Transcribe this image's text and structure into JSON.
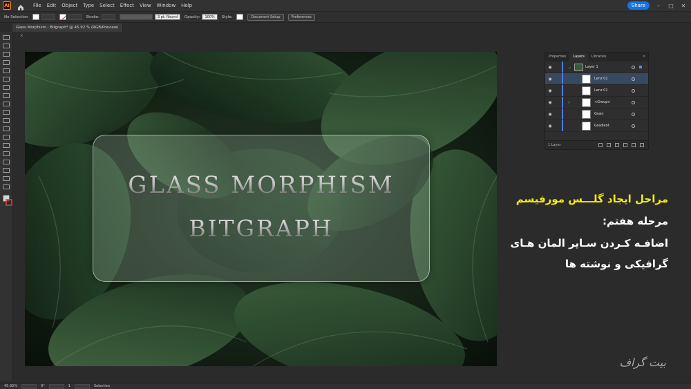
{
  "menubar": {
    "app_icon": "Ai",
    "items": [
      "File",
      "Edit",
      "Object",
      "Type",
      "Select",
      "Effect",
      "View",
      "Window",
      "Help"
    ],
    "share_label": "Share",
    "window_controls": [
      "–",
      "□",
      "✕"
    ]
  },
  "controlbar": {
    "selection_label": "No Selection",
    "stroke_label": "Stroke:",
    "brush_value": "3 pt. Round",
    "opacity_label": "Opacity:",
    "opacity_value": "100%",
    "style_label": "Style:",
    "document_setup_label": "Document Setup",
    "preferences_label": "Preferences"
  },
  "document": {
    "tab_title": "Glass Morphism - Bitgraph* @ 45.92 % (RGB/Preview)",
    "tab_close": "×"
  },
  "artwork": {
    "line1": "GLASS MORPHISM",
    "line2": "BITGRAPH"
  },
  "layers_panel": {
    "tabs": [
      "Properties",
      "Layers",
      "Libraries"
    ],
    "active_tab": "Layers",
    "rows": [
      {
        "name": "Layer 1"
      },
      {
        "name": "Lenz 02"
      },
      {
        "name": "Lenz 01"
      },
      {
        "name": "<Group>"
      },
      {
        "name": "Grain"
      },
      {
        "name": "Gradient"
      }
    ],
    "footer_label": "1 Layer"
  },
  "overlay_text": {
    "title": "مراحل ایجاد گلـــس مورفیسم",
    "step": "مرحله هفتم:",
    "line3": "اضافـه کـردن سـایر المان هـای",
    "line4": "گرافیکی و نوشته ها",
    "watermark": "بیت گراف"
  },
  "statusbar": {
    "zoom": "45.92%",
    "rotation": "0°",
    "artboard": "1",
    "tool": "Selection"
  },
  "colors": {
    "accent_blue": "#1473e6",
    "title_yellow": "#f5ea14",
    "selected_row": "#36495f"
  }
}
